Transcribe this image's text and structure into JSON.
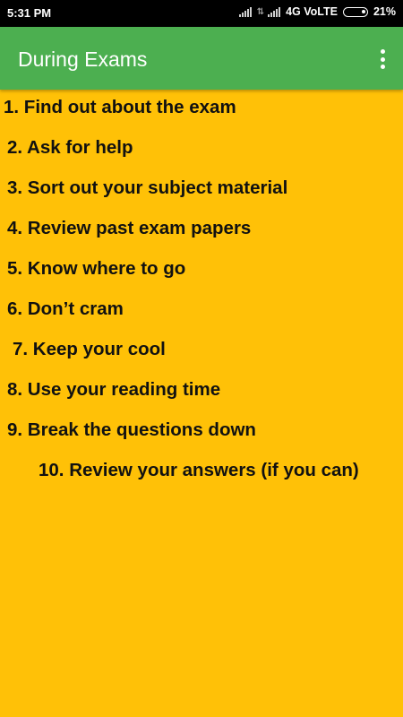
{
  "status_bar": {
    "time": "5:31 PM",
    "network": "4G VoLTE",
    "battery_percent": "21%",
    "battery_level": 0.21,
    "icons": [
      "signal-icon",
      "data-arrows-icon",
      "signal-icon",
      "battery-icon"
    ]
  },
  "app_bar": {
    "title": "During Exams",
    "menu_icon": "more-vert-icon",
    "color": "#4CAF50"
  },
  "background_color": "#FFC107",
  "list": {
    "items": [
      "1. Find out about the exam",
      "2. Ask for help",
      "3. Sort out your subject material",
      "4. Review past exam papers",
      "5. Know where to go",
      "6. Don’t cram",
      "7. Keep your cool",
      "8. Use your reading time",
      "9. Break the questions down",
      "10. Review your answers (if you can)"
    ]
  }
}
